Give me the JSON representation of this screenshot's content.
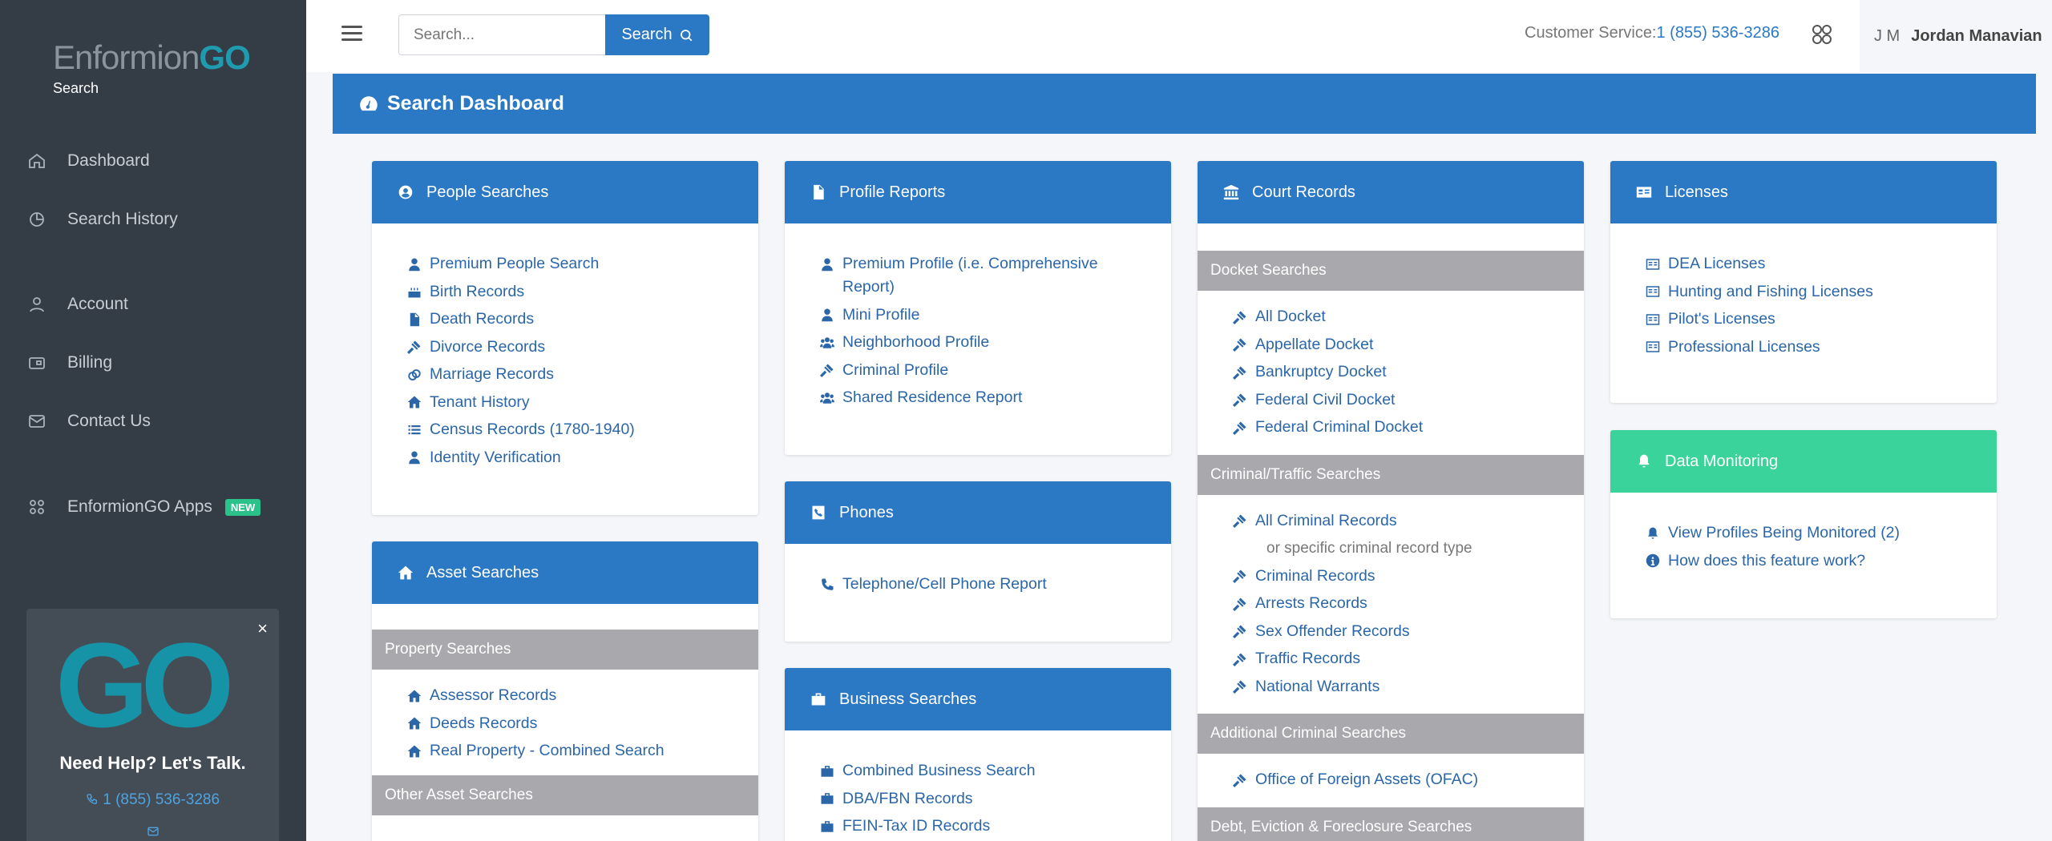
{
  "brand": {
    "logo_main": "Enformion",
    "logo_go": "GO",
    "subtitle": "Search"
  },
  "sidebar": {
    "items": [
      {
        "label": "Dashboard",
        "icon": "home-icon"
      },
      {
        "label": "Search History",
        "icon": "history-icon"
      },
      {
        "label": "Account",
        "icon": "user-icon"
      },
      {
        "label": "Billing",
        "icon": "billing-icon"
      },
      {
        "label": "Contact Us",
        "icon": "mail-icon"
      },
      {
        "label": "EnformionGO Apps",
        "icon": "apps-icon",
        "badge": "NEW"
      }
    ],
    "help": {
      "logo": "GO",
      "title": "Need Help? Let's Talk.",
      "phone": "1 (855) 536-3286",
      "close": "×"
    }
  },
  "topbar": {
    "search_placeholder": "Search...",
    "search_button": "Search",
    "cs_label": "Customer Service:",
    "cs_phone": "1 (855) 536-3286",
    "user_initials": "J M",
    "user_name": "Jordan Manavian"
  },
  "dashboard": {
    "title": "Search Dashboard"
  },
  "cards": {
    "people": {
      "title": "People Searches",
      "links": [
        "Premium People Search",
        "Birth Records",
        "Death Records",
        "Divorce Records",
        "Marriage Records",
        "Tenant History",
        "Census Records (1780-1940)",
        "Identity Verification"
      ]
    },
    "asset": {
      "title": "Asset Searches",
      "section1": "Property Searches",
      "links": [
        "Assessor Records",
        "Deeds Records",
        "Real Property - Combined Search"
      ],
      "section2": "Other Asset Searches"
    },
    "profile": {
      "title": "Profile Reports",
      "links": [
        "Premium Profile (i.e. Comprehensive Report)",
        "Mini Profile",
        "Neighborhood Profile",
        "Criminal Profile",
        "Shared Residence Report"
      ]
    },
    "phones": {
      "title": "Phones",
      "links": [
        "Telephone/Cell Phone Report"
      ]
    },
    "business": {
      "title": "Business Searches",
      "links": [
        "Combined Business Search",
        "DBA/FBN Records",
        "FEIN-Tax ID Records"
      ]
    },
    "court": {
      "title": "Court Records",
      "docket_section": "Docket Searches",
      "docket_links": [
        "All Docket",
        "Appellate Docket",
        "Bankruptcy Docket",
        "Federal Civil Docket",
        "Federal Criminal Docket"
      ],
      "criminal_section": "Criminal/Traffic Searches",
      "criminal_first": "All Criminal Records",
      "criminal_note": "or specific criminal record type",
      "criminal_links": [
        "Criminal Records",
        "Arrests Records",
        "Sex Offender Records",
        "Traffic Records",
        "National Warrants"
      ],
      "additional_section": "Additional Criminal Searches",
      "additional_links": [
        "Office of Foreign Assets (OFAC)"
      ],
      "debt_section": "Debt, Eviction & Foreclosure Searches"
    },
    "licenses": {
      "title": "Licenses",
      "links": [
        "DEA Licenses",
        "Hunting and Fishing Licenses",
        "Pilot's Licenses",
        "Professional Licenses"
      ]
    },
    "monitoring": {
      "title": "Data Monitoring",
      "links": [
        "View Profiles Being Monitored (2)",
        "How does this feature work?"
      ]
    }
  },
  "colors": {
    "primary": "#2b78c5",
    "sidebar": "#343d46",
    "green": "#3bd39c",
    "section": "#a9a9ad",
    "link": "#2b66a8"
  }
}
